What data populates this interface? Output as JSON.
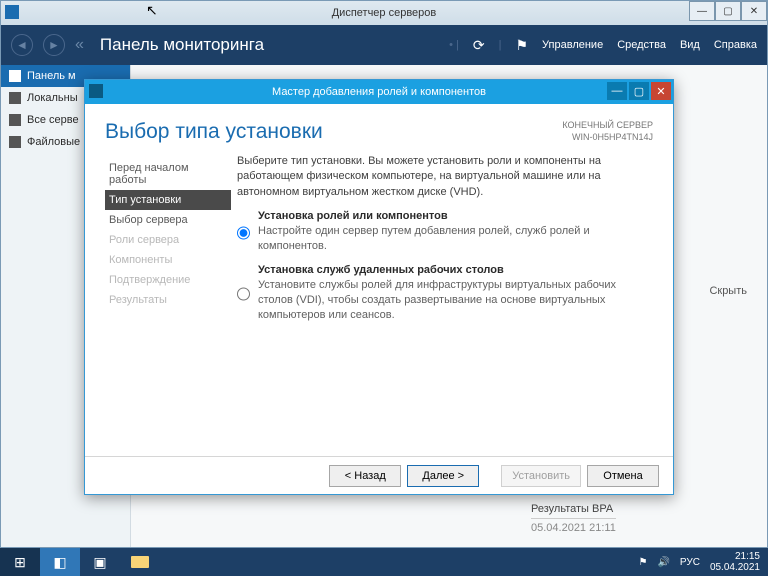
{
  "server_manager": {
    "title": "Диспетчер серверов",
    "header_title": "Панель мониторинга",
    "menu": {
      "manage": "Управление",
      "tools": "Средства",
      "view": "Вид",
      "help": "Справка"
    },
    "sidebar": {
      "items": [
        {
          "label": "Панель м"
        },
        {
          "label": "Локальны"
        },
        {
          "label": "Все серве"
        },
        {
          "label": "Файловые"
        }
      ]
    },
    "hide": "Скрыть",
    "bpa_label": "Результаты BPA",
    "bpa_time": "05.04.2021 21:11"
  },
  "wizard": {
    "title": "Мастер добавления ролей и компонентов",
    "heading": "Выбор типа установки",
    "dest_label": "КОНЕЧНЫЙ СЕРВЕР",
    "dest_server": "WIN-0H5HP4TN14J",
    "intro": "Выберите тип установки. Вы можете установить роли и компоненты на работающем физическом компьютере, на виртуальной машине или на автономном виртуальном жестком диске (VHD).",
    "steps": [
      "Перед началом работы",
      "Тип установки",
      "Выбор сервера",
      "Роли сервера",
      "Компоненты",
      "Подтверждение",
      "Результаты"
    ],
    "options": [
      {
        "title": "Установка ролей или компонентов",
        "desc": "Настройте один сервер путем добавления ролей, служб ролей и компонентов."
      },
      {
        "title": "Установка служб удаленных рабочих столов",
        "desc": "Установите службы ролей для инфраструктуры виртуальных рабочих столов (VDI), чтобы создать развертывание на основе виртуальных компьютеров или сеансов."
      }
    ],
    "buttons": {
      "back": "< Назад",
      "next": "Далее >",
      "install": "Установить",
      "cancel": "Отмена"
    }
  },
  "taskbar": {
    "lang": "РУС",
    "time": "21:15",
    "date": "05.04.2021"
  }
}
